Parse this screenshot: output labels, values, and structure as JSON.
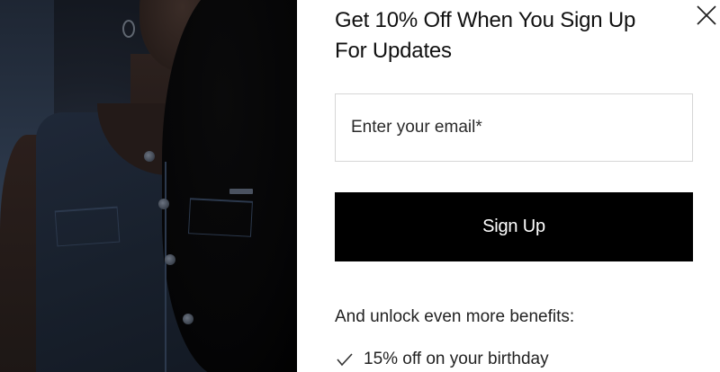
{
  "popup": {
    "title": "Get 10% Off When You Sign Up For Updates",
    "email_placeholder": "Enter your email*",
    "email_value": "",
    "submit_label": "Sign Up",
    "benefits_title": "And unlock even more benefits:",
    "benefits": [
      {
        "icon": "check-icon",
        "label": "15% off on your birthday"
      }
    ]
  },
  "colors": {
    "button_bg": "#000000",
    "button_text": "#ffffff",
    "text": "#1a1a1a",
    "input_border": "#d6d6d6"
  }
}
